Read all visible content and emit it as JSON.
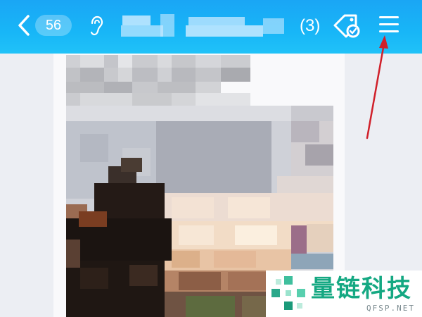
{
  "header": {
    "unread_count": "56",
    "chat_title": "",
    "member_count": "(3)",
    "background": "#1aa6f5"
  },
  "icons": {
    "back": "chevron-left",
    "voice": "ear",
    "task": "tag-checkmark",
    "menu": "hamburger"
  },
  "annotation": {
    "color": "#d0202a",
    "target": "menu-button"
  },
  "watermark": {
    "brand": "量链科技",
    "domain": "QFSP.NET",
    "color": "#14a882"
  }
}
